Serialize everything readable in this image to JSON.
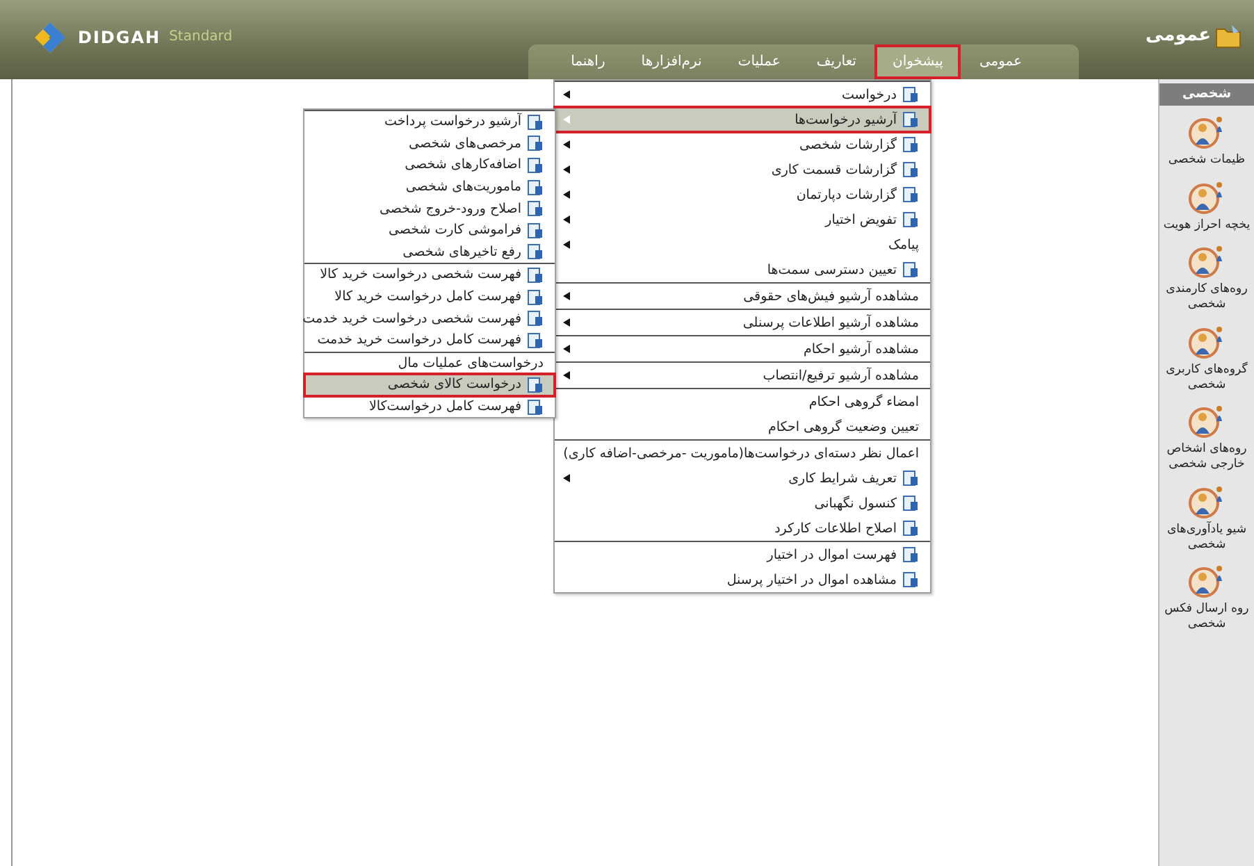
{
  "logo": {
    "brand": "DIDGAH",
    "edition": "Standard"
  },
  "header": {
    "title": "عمومی"
  },
  "tabs": [
    {
      "label": "عمومی",
      "selected": false,
      "marked": false
    },
    {
      "label": "پیشخوان",
      "selected": true,
      "marked": true
    },
    {
      "label": "تعاریف",
      "selected": false,
      "marked": false
    },
    {
      "label": "عملیات",
      "selected": false,
      "marked": false
    },
    {
      "label": "نرم‌افزارها",
      "selected": false,
      "marked": false
    },
    {
      "label": "راهنما",
      "selected": false,
      "marked": false
    }
  ],
  "main_menu": {
    "groups": [
      {
        "items": [
          {
            "label": "درخواست",
            "has_icon": true,
            "has_submenu": true,
            "selected": false,
            "marked": false
          },
          {
            "label": "آرشیو درخواست‌ها",
            "has_icon": true,
            "has_submenu": true,
            "selected": true,
            "marked": true
          },
          {
            "label": "گزارشات شخصی",
            "has_icon": true,
            "has_submenu": true,
            "selected": false,
            "marked": false
          },
          {
            "label": "گزارشات قسمت کاری",
            "has_icon": true,
            "has_submenu": true,
            "selected": false,
            "marked": false
          },
          {
            "label": "گزارشات دپارتمان",
            "has_icon": true,
            "has_submenu": true,
            "selected": false,
            "marked": false
          },
          {
            "label": "تفویض اختیار",
            "has_icon": true,
            "has_submenu": true,
            "selected": false,
            "marked": false
          },
          {
            "label": "پیامک",
            "has_icon": false,
            "has_submenu": true,
            "selected": false,
            "marked": false
          },
          {
            "label": "تعیین دسترسی سمت‌ها",
            "has_icon": true,
            "has_submenu": false,
            "selected": false,
            "marked": false
          }
        ]
      },
      {
        "items": [
          {
            "label": "مشاهده آرشیو فیش‌های حقوقی",
            "has_icon": false,
            "has_submenu": true,
            "selected": false,
            "marked": false
          }
        ]
      },
      {
        "items": [
          {
            "label": "مشاهده آرشیو اطلاعات پرسنلی",
            "has_icon": false,
            "has_submenu": true,
            "selected": false,
            "marked": false
          }
        ]
      },
      {
        "items": [
          {
            "label": "مشاهده آرشیو احکام",
            "has_icon": false,
            "has_submenu": true,
            "selected": false,
            "marked": false
          }
        ]
      },
      {
        "items": [
          {
            "label": "مشاهده آرشیو ترفیع/انتصاب",
            "has_icon": false,
            "has_submenu": true,
            "selected": false,
            "marked": false
          }
        ]
      },
      {
        "items": [
          {
            "label": "امضاء گروهی احکام",
            "has_icon": false,
            "has_submenu": false,
            "selected": false,
            "marked": false
          },
          {
            "label": "تعیین وضعیت گروهی احکام",
            "has_icon": false,
            "has_submenu": false,
            "selected": false,
            "marked": false
          }
        ]
      },
      {
        "items": [
          {
            "label": "اعمال نظر دسته‌ای درخواست‌ها(ماموریت -مرخصی-اضافه کاری)",
            "has_icon": false,
            "has_submenu": false,
            "selected": false,
            "marked": false
          },
          {
            "label": "تعریف شرایط کاری",
            "has_icon": true,
            "has_submenu": true,
            "selected": false,
            "marked": false
          },
          {
            "label": "کنسول نگهبانی",
            "has_icon": true,
            "has_submenu": false,
            "selected": false,
            "marked": false
          },
          {
            "label": "اصلاح اطلاعات کارکرد",
            "has_icon": true,
            "has_submenu": false,
            "selected": false,
            "marked": false
          }
        ]
      },
      {
        "items": [
          {
            "label": "فهرست اموال در اختیار",
            "has_icon": true,
            "has_submenu": false,
            "selected": false,
            "marked": false
          },
          {
            "label": "مشاهده اموال در اختیار پرسنل",
            "has_icon": true,
            "has_submenu": false,
            "selected": false,
            "marked": false
          }
        ]
      }
    ]
  },
  "sub_menu": {
    "groups": [
      {
        "items": [
          {
            "label": "آرشیو درخواست پرداخت",
            "has_icon": true,
            "has_submenu": false,
            "selected": false,
            "marked": false
          },
          {
            "label": "مرخصی‌های شخصی",
            "has_icon": true,
            "has_submenu": false,
            "selected": false,
            "marked": false
          },
          {
            "label": "اضافه‌کارهای شخصی",
            "has_icon": true,
            "has_submenu": false,
            "selected": false,
            "marked": false
          },
          {
            "label": "ماموریت‌های شخصی",
            "has_icon": true,
            "has_submenu": false,
            "selected": false,
            "marked": false
          },
          {
            "label": "اصلاح ورود-خروج شخصی",
            "has_icon": true,
            "has_submenu": false,
            "selected": false,
            "marked": false
          },
          {
            "label": "فراموشی کارت شخصی",
            "has_icon": true,
            "has_submenu": false,
            "selected": false,
            "marked": false
          },
          {
            "label": "رفع تاخیرهای شخصی",
            "has_icon": true,
            "has_submenu": false,
            "selected": false,
            "marked": false
          }
        ]
      },
      {
        "items": [
          {
            "label": "فهرست شخصی درخواست خرید کالا",
            "has_icon": true,
            "has_submenu": false,
            "selected": false,
            "marked": false
          },
          {
            "label": "فهرست کامل درخواست خرید کالا",
            "has_icon": true,
            "has_submenu": false,
            "selected": false,
            "marked": false
          },
          {
            "label": "فهرست شخصی درخواست خرید خدمت",
            "has_icon": true,
            "has_submenu": false,
            "selected": false,
            "marked": false
          },
          {
            "label": "فهرست کامل درخواست خرید خدمت",
            "has_icon": true,
            "has_submenu": false,
            "selected": false,
            "marked": false
          }
        ]
      },
      {
        "items": [
          {
            "label": "درخواست‌های عملیات مال",
            "has_icon": false,
            "has_submenu": false,
            "selected": false,
            "marked": false
          },
          {
            "label": "درخواست کالای شخصی",
            "has_icon": true,
            "has_submenu": false,
            "selected": true,
            "marked": true
          },
          {
            "label": "فهرست کامل درخواست‌کالا",
            "has_icon": true,
            "has_submenu": false,
            "selected": false,
            "marked": false
          }
        ]
      }
    ]
  },
  "sidebar": {
    "title": "شخصی",
    "items": [
      {
        "label": "ظیمات شخصی"
      },
      {
        "label": "یخچه احراز هویت"
      },
      {
        "label": "روه‌های کارمندی شخصی"
      },
      {
        "label": "گروه‌های کاربری شخصی"
      },
      {
        "label": "روه‌های اشخاص خارجی شخصی"
      },
      {
        "label": "شیو یادآوری‌های شخصی"
      },
      {
        "label": "روه ارسال فکس شخصی"
      }
    ]
  }
}
